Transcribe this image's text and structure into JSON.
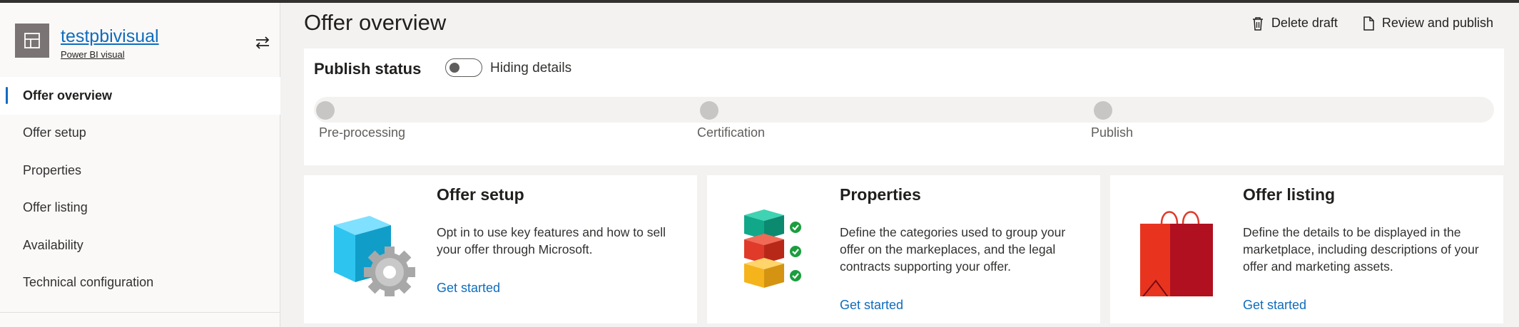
{
  "sidebar": {
    "offer_name": "testpbivisual",
    "offer_type": "Power BI visual",
    "nav": [
      {
        "label": "Offer overview",
        "active": true
      },
      {
        "label": "Offer setup",
        "active": false
      },
      {
        "label": "Properties",
        "active": false
      },
      {
        "label": "Offer listing",
        "active": false
      },
      {
        "label": "Availability",
        "active": false
      },
      {
        "label": "Technical configuration",
        "active": false
      }
    ]
  },
  "header": {
    "title": "Offer overview",
    "delete_label": "Delete draft",
    "review_label": "Review and publish"
  },
  "status": {
    "title": "Publish status",
    "toggle_label": "Hiding details",
    "toggle_on": false,
    "steps": [
      "Pre-processing",
      "Certification",
      "Publish"
    ]
  },
  "cards": [
    {
      "title": "Offer setup",
      "description": "Opt in to use key features and how to sell your offer through Microsoft.",
      "link": "Get started",
      "icon": "cube-gear-icon"
    },
    {
      "title": "Properties",
      "description": "Define the categories used to group your offer on the markeplaces, and the legal contracts supporting your offer.",
      "link": "Get started",
      "icon": "stacked-blocks-check-icon"
    },
    {
      "title": "Offer listing",
      "description": "Define the details to be displayed in the marketplace, including descriptions of your offer and marketing assets.",
      "link": "Get started",
      "icon": "shopping-bag-icon"
    }
  ],
  "colors": {
    "accent": "#0f6cbd",
    "page_bg": "#f3f2f1",
    "step_dot": "#c8c6c4"
  }
}
